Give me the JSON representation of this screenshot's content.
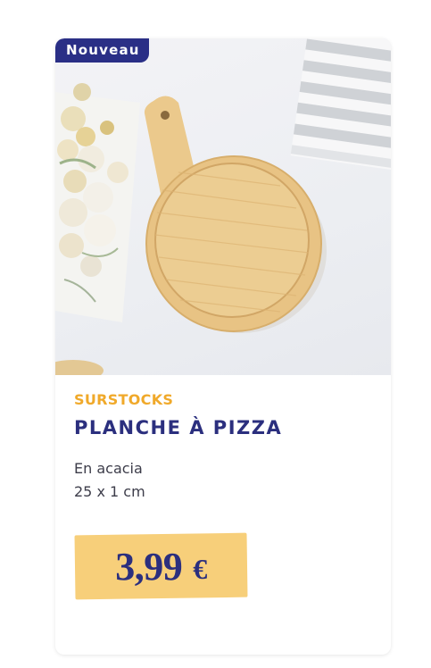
{
  "product": {
    "badge": "Nouveau",
    "brand": "SURSTOCKS",
    "title": "PLANCHE À PIZZA",
    "description_line1": "En acacia",
    "description_line2": "25 x 1 cm",
    "price_amount": "3,99",
    "price_currency": "€",
    "image_icon": "pizza-board-photo"
  },
  "colors": {
    "brand_accent": "#f0a92a",
    "title_blue": "#2b2f7e",
    "badge_bg": "#2a2f86",
    "price_bg": "#f7cf7a"
  }
}
